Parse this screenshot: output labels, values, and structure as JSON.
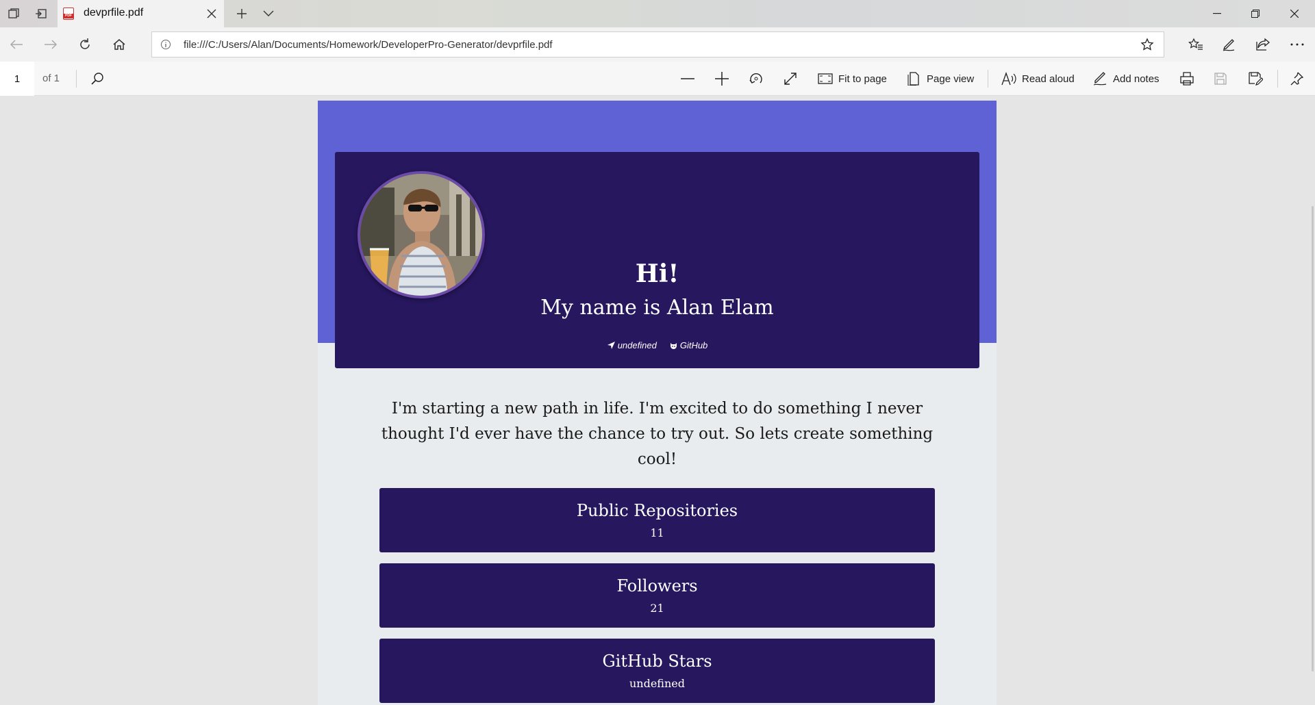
{
  "browser": {
    "tab_title": "devprfile.pdf",
    "url": "file:///C:/Users/Alan/Documents/Homework/DeveloperPro-Generator/devprfile.pdf"
  },
  "pdf_toolbar": {
    "current_page": "1",
    "page_count": "of 1",
    "fit_to_page": "Fit to page",
    "page_view": "Page view",
    "read_aloud": "Read aloud",
    "add_notes": "Add notes"
  },
  "profile": {
    "greeting": "Hi!",
    "name": "My name is Alan Elam",
    "location_link": "undefined",
    "github_link": "GitHub",
    "bio": "I'm starting a new path in life. I'm excited to do something I never thought I'd ever have the chance to try out. So lets create something cool!",
    "stats": [
      {
        "label": "Public Repositories",
        "value": "11"
      },
      {
        "label": "Followers",
        "value": "21"
      },
      {
        "label": "GitHub Stars",
        "value": "undefined"
      }
    ]
  },
  "colors": {
    "banner": "#5f62d4",
    "card": "#26175e",
    "page_bg": "#e8ecee"
  }
}
